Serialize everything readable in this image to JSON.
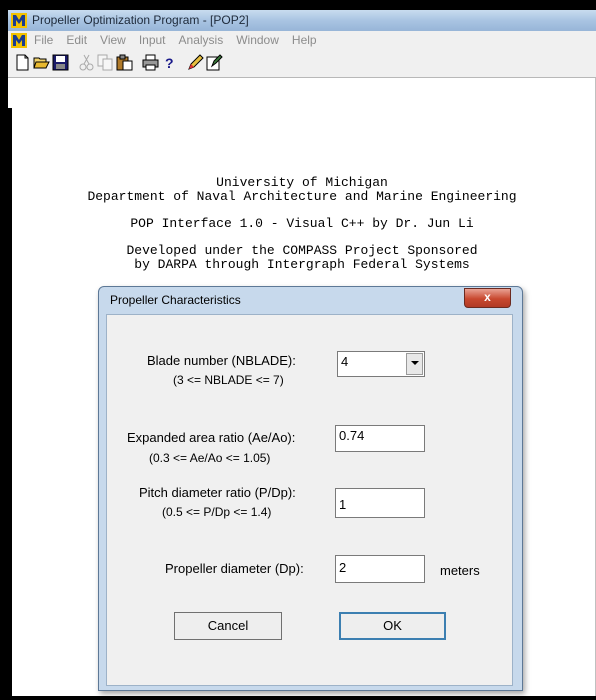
{
  "window": {
    "title": "Propeller Optimization Program - [POP2]"
  },
  "menu": {
    "items": [
      "File",
      "Edit",
      "View",
      "Input",
      "Analysis",
      "Window",
      "Help"
    ]
  },
  "toolbar": {
    "buttons": [
      {
        "icon": "new-icon"
      },
      {
        "icon": "open-icon"
      },
      {
        "icon": "save-icon"
      },
      {
        "icon": "cut-icon"
      },
      {
        "icon": "copy-icon"
      },
      {
        "icon": "paste-icon"
      },
      {
        "icon": "print-icon"
      },
      {
        "icon": "help-icon"
      },
      {
        "icon": "edit-icon"
      },
      {
        "icon": "notes-icon"
      }
    ]
  },
  "document": {
    "lines": [
      "University of Michigan",
      "Department of Naval Architecture and Marine Engineering",
      "POP Interface 1.0 - Visual C++ by Dr. Jun Li",
      "Developed under the COMPASS Project Sponsored",
      "by DARPA through Intergraph Federal Systems"
    ]
  },
  "dialog": {
    "title": "Propeller Characteristics",
    "close": "x",
    "blade_label": "Blade number (NBLADE):",
    "blade_range": "(3 <= NBLADE <= 7)",
    "blade_value": "4",
    "area_label": "Expanded area ratio (Ae/Ao):",
    "area_range": "(0.3 <= Ae/Ao <= 1.05)",
    "area_value": "0.74",
    "pitch_label": "Pitch diameter ratio (P/Dp):",
    "pitch_range": "(0.5 <= P/Dp <= 1.4)",
    "pitch_value": "1",
    "diameter_label": "Propeller diameter (Dp):",
    "diameter_value": "2",
    "diameter_unit": "meters",
    "cancel_label": "Cancel",
    "ok_label": "OK"
  },
  "colors": {
    "titlebar": "#a9c4e2",
    "dialog_frame": "#c7d9ec",
    "close_button": "#c8482f",
    "ok_border": "#3c7fb1"
  }
}
